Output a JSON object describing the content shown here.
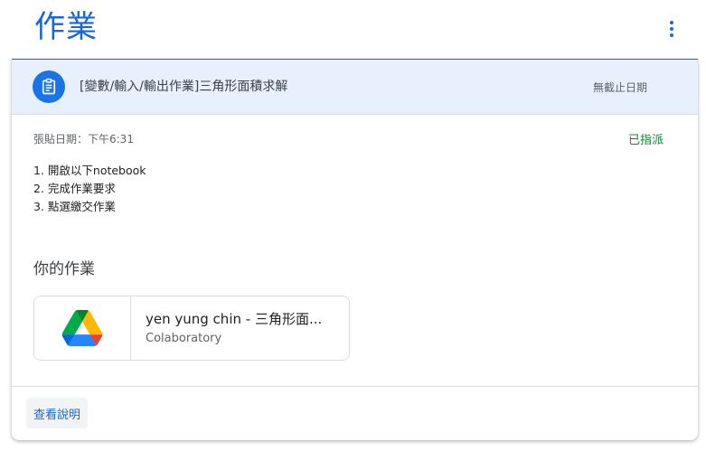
{
  "page": {
    "title": "作業"
  },
  "toolbar": {
    "more_icon": "more-vert-icon"
  },
  "assignment": {
    "icon": "assignment-icon",
    "title": "[變數/輸入/輸出作業]三角形面積求解",
    "due": "無截止日期",
    "posted": "張貼日期：下午6:31",
    "status": "已指派",
    "status_color": "#188038",
    "instructions": [
      "1. 開啟以下notebook",
      "2. 完成作業要求",
      "3. 點選繳交作業"
    ]
  },
  "your_work": {
    "heading": "你的作業",
    "attachment": {
      "icon": "google-drive-icon",
      "title": "yen yung chin - 三角形面...",
      "subtitle": "Colaboratory"
    }
  },
  "footer": {
    "view_instructions_label": "查看說明"
  },
  "colors": {
    "accent": "#1967d2",
    "header_bg": "#e8f0fe"
  }
}
